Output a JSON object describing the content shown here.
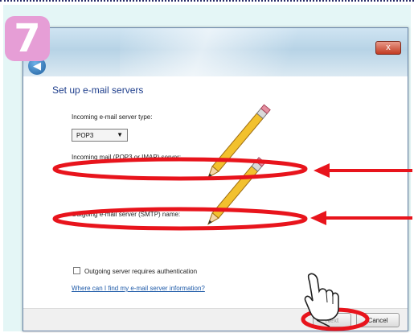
{
  "step": {
    "number": "7"
  },
  "window": {
    "close_glyph": "x",
    "back_glyph": "◀"
  },
  "form": {
    "heading": "Set up e-mail servers",
    "incoming_type_label": "Incoming e-mail server type:",
    "incoming_type_value": "POP3",
    "incoming_server_label": "Incoming mail (POP3 or IMAP) server:",
    "incoming_server_value": "",
    "outgoing_server_label": "Outgoing e-mail server (SMTP) name:",
    "outgoing_server_value": "",
    "auth_checkbox_label": "Outgoing server requires authentication",
    "auth_checked": false,
    "help_link": "Where can I find my e-mail server information?"
  },
  "footer": {
    "next_label": "Next",
    "cancel_label": "Cancel"
  },
  "annotations": {
    "highlight_color": "#e8141c",
    "pencil_color": "#f2c12e"
  }
}
